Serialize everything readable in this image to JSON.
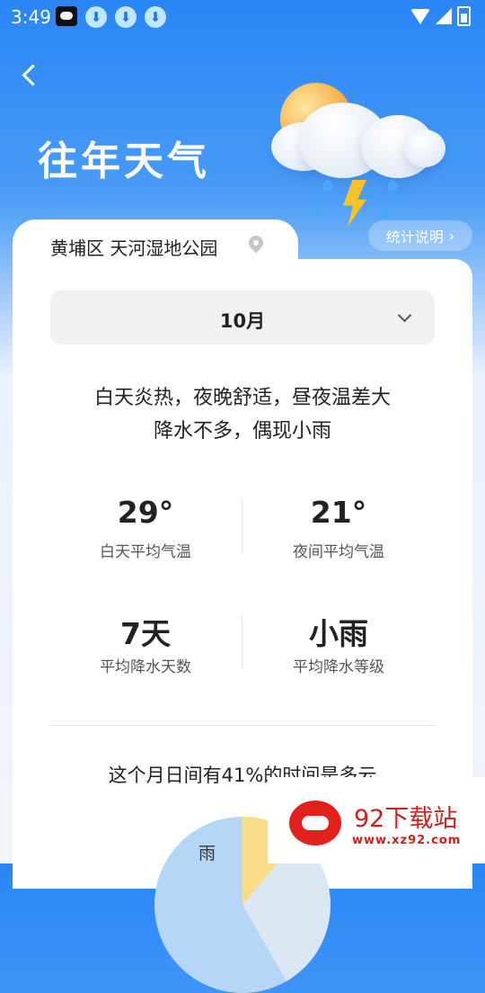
{
  "status_bar": {
    "time": "3:49",
    "icons": [
      "weather-app-icon",
      "download-icon",
      "download-icon",
      "download-icon",
      "wifi-icon",
      "signal-icon",
      "battery-icon"
    ]
  },
  "header": {
    "title": "往年天气",
    "back_icon": "chevron-left-icon"
  },
  "location": {
    "text": "黄埔区 天河湿地公园",
    "icon": "location-pin-icon"
  },
  "stats_link": {
    "label": "统计说明",
    "icon": "chevron-right-icon"
  },
  "month_select": {
    "value": "10月"
  },
  "description": {
    "line1": "白天炎热，夜晚舒适，昼夜温差大",
    "line2": "降水不多，偶现小雨"
  },
  "stats": {
    "day_temp": {
      "value": "29°",
      "label": "白天平均气温"
    },
    "night_temp": {
      "value": "21°",
      "label": "夜间平均气温"
    },
    "rain_days": {
      "value": "7天",
      "label": "平均降水天数"
    },
    "rain_level": {
      "value": "小雨",
      "label": "平均降水等级"
    }
  },
  "cloud_summary": "这个月日间有41%的时间是多云",
  "pie": {
    "rain_label": "雨"
  },
  "watermark": {
    "title": "92下载站",
    "url": "www.xz92.com"
  },
  "colors": {
    "header_blue": "#2a86f5",
    "accent_sun": "#f3a53a",
    "pie_yellow": "#fbdc86",
    "pie_blue": "#b6d6f8",
    "watermark_red": "#d0201d"
  }
}
